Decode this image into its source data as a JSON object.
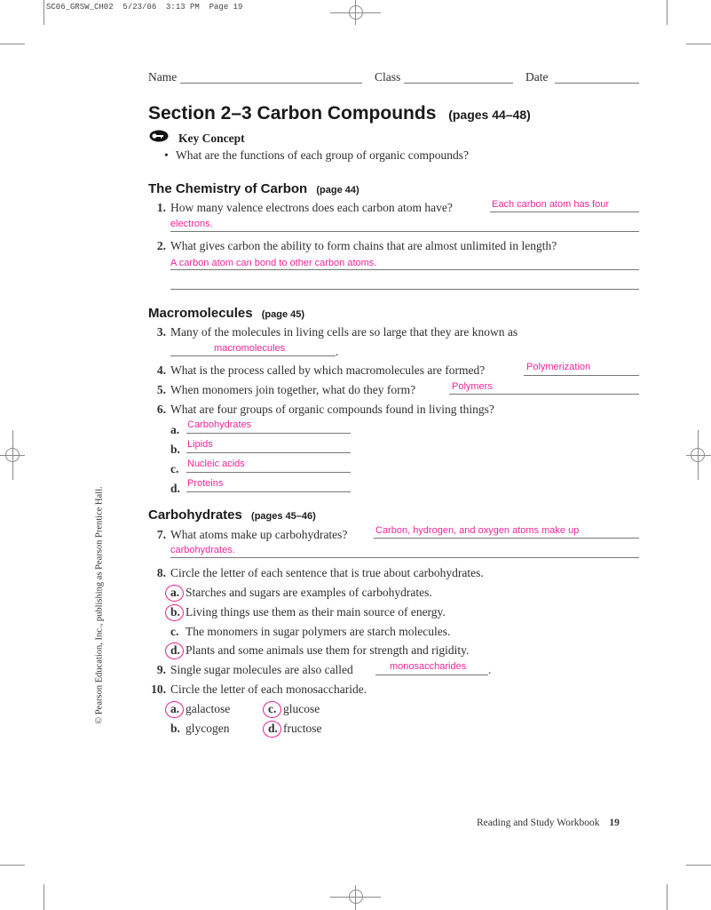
{
  "slug": "SC06_GRSW_CH02  5/23/06  3:13 PM  Page 19",
  "header_fields": {
    "name_label": "Name",
    "class_label": "Class",
    "date_label": "Date"
  },
  "title": {
    "main": "Section 2–3  Carbon Compounds",
    "pages": "(pages 44–48)"
  },
  "key_concept": {
    "icon": "key-icon",
    "label": "Key Concept",
    "bullet": "What are the functions of each group of organic compounds?"
  },
  "sections": [
    {
      "heading": "The Chemistry of Carbon",
      "pages": "(page 44)"
    },
    {
      "heading": "Macromolecules",
      "pages": "(page 45)"
    },
    {
      "heading": "Carbohydrates",
      "pages": "(pages 45–46)"
    }
  ],
  "questions": {
    "q1": {
      "num": "1.",
      "text": "How many valence electrons does each carbon atom have?",
      "answer_line1": "Each carbon atom has four",
      "answer_line2": "electrons."
    },
    "q2": {
      "num": "2.",
      "text": "What gives carbon the ability to form chains that are almost unlimited in length?",
      "answer_line1": "A carbon atom can bond to other carbon atoms.",
      "answer_line2": ""
    },
    "q3": {
      "num": "3.",
      "text": "Many of the molecules in living cells are so large that they are known as",
      "answer": "macromolecules",
      "end": "."
    },
    "q4": {
      "num": "4.",
      "text": "What is the process called by which macromolecules are formed?",
      "answer": "Polymerization"
    },
    "q5": {
      "num": "5.",
      "text": "When monomers join together, what do they form?",
      "answer": "Polymers"
    },
    "q6": {
      "num": "6.",
      "text": "What are four groups of organic compounds found in living things?",
      "items": [
        {
          "letter": "a.",
          "answer": "Carbohydrates"
        },
        {
          "letter": "b.",
          "answer": "Lipids"
        },
        {
          "letter": "c.",
          "answer": "Nucleic acids"
        },
        {
          "letter": "d.",
          "answer": "Proteins"
        }
      ]
    },
    "q7": {
      "num": "7.",
      "text": "What atoms make up carbohydrates?",
      "answer_line1": "Carbon, hydrogen, and oxygen atoms make up",
      "answer_line2": "carbohydrates."
    },
    "q8": {
      "num": "8.",
      "text": "Circle the letter of each sentence that is true about carbohydrates.",
      "items": [
        {
          "letter": "a.",
          "text": "Starches and sugars are examples of carbohydrates.",
          "circled": true
        },
        {
          "letter": "b.",
          "text": "Living things use them as their main source of energy.",
          "circled": true
        },
        {
          "letter": "c.",
          "text": "The monomers in sugar polymers are starch molecules.",
          "circled": false
        },
        {
          "letter": "d.",
          "text": "Plants and some animals use them for strength and rigidity.",
          "circled": true
        }
      ]
    },
    "q9": {
      "num": "9.",
      "text": "Single sugar molecules are also called",
      "answer": "monosaccharides",
      "end": "."
    },
    "q10": {
      "num": "10.",
      "text": "Circle the letter of each monosaccharide.",
      "items": [
        {
          "letter": "a.",
          "text": "galactose",
          "circled": true
        },
        {
          "letter": "c.",
          "text": "glucose",
          "circled": true
        },
        {
          "letter": "b.",
          "text": "glycogen",
          "circled": false
        },
        {
          "letter": "d.",
          "text": "fructose",
          "circled": true
        }
      ]
    }
  },
  "copyright": "© Pearson Education, Inc., publishing as Pearson Prentice Hall.",
  "footer": {
    "book": "Reading and Study Workbook",
    "page": "19"
  },
  "colors": {
    "answer": "#f0249a",
    "circle": "#e8218e"
  }
}
